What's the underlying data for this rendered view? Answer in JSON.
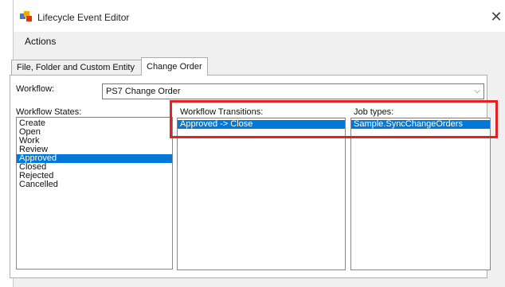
{
  "window": {
    "title": "Lifecycle Event Editor",
    "close_glyph": "✕"
  },
  "menu": {
    "items": [
      "Actions"
    ]
  },
  "tabs": [
    {
      "label": "File, Folder and Custom Entity",
      "active": false
    },
    {
      "label": "Change Order",
      "active": true
    }
  ],
  "workflow": {
    "label": "Workflow:",
    "value": "PS7 Change Order",
    "dropdown_glyph": "⌵"
  },
  "states": {
    "label": "Workflow States:",
    "items": [
      "Create",
      "Open",
      "Work",
      "Review",
      "Approved",
      "Closed",
      "Rejected",
      "Cancelled"
    ],
    "selected": "Approved"
  },
  "transitions": {
    "label": "Workflow Transitions:",
    "items": [
      "Approved -> Close"
    ],
    "selected": "Approved -> Close"
  },
  "jobs": {
    "label": "Job types:",
    "items": [
      "Sample.SyncChangeOrders"
    ],
    "selected": "Sample.SyncChangeOrders"
  },
  "colors": {
    "selection": "#0078d7",
    "highlight": "#e3211e"
  },
  "icons": {
    "app": "lifecycle-editor-icon",
    "close": "close-icon",
    "dropdown": "chevron-down-icon"
  }
}
